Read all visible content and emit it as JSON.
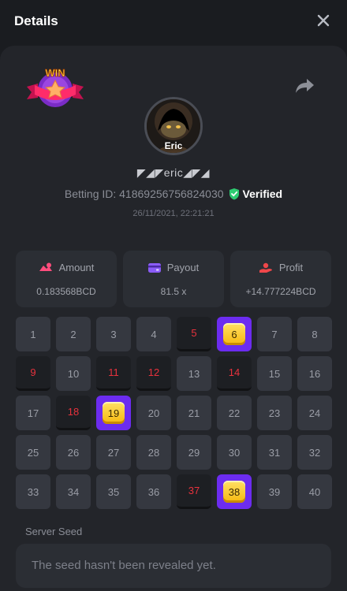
{
  "header": {
    "title": "Details"
  },
  "profile": {
    "badge_text": "WIN",
    "avatar_name": "Eric",
    "username": "◤◢◤eric◢◤◢",
    "betting_label": "Betting ID: 41869256756824030",
    "verified_label": "Verified",
    "datetime": "26/11/2021, 22:21:21"
  },
  "stats": [
    {
      "label": "Amount",
      "value": "0.183568BCD",
      "icon": "amount-icon"
    },
    {
      "label": "Payout",
      "value": "81.5 x",
      "icon": "wallet-icon"
    },
    {
      "label": "Profit",
      "value": "+14.777224BCD",
      "icon": "profit-icon"
    }
  ],
  "grid": {
    "numbers": [
      "1",
      "2",
      "3",
      "4",
      "5",
      "6",
      "7",
      "8",
      "9",
      "10",
      "11",
      "12",
      "13",
      "14",
      "15",
      "16",
      "17",
      "18",
      "19",
      "20",
      "21",
      "22",
      "23",
      "24",
      "25",
      "26",
      "27",
      "28",
      "29",
      "30",
      "31",
      "32",
      "33",
      "34",
      "35",
      "36",
      "37",
      "38",
      "39",
      "40"
    ],
    "hits": [
      5,
      9,
      11,
      12,
      14,
      18,
      37
    ],
    "matches": [
      6,
      19,
      38
    ]
  },
  "seed": {
    "label": "Server Seed",
    "value": "The seed hasn't been revealed yet."
  },
  "colors": {
    "accent_purple": "#6c2cf0",
    "hit_red": "#e8323d",
    "verified_green": "#2ecc71",
    "gem_gold": "#f6b80d"
  }
}
